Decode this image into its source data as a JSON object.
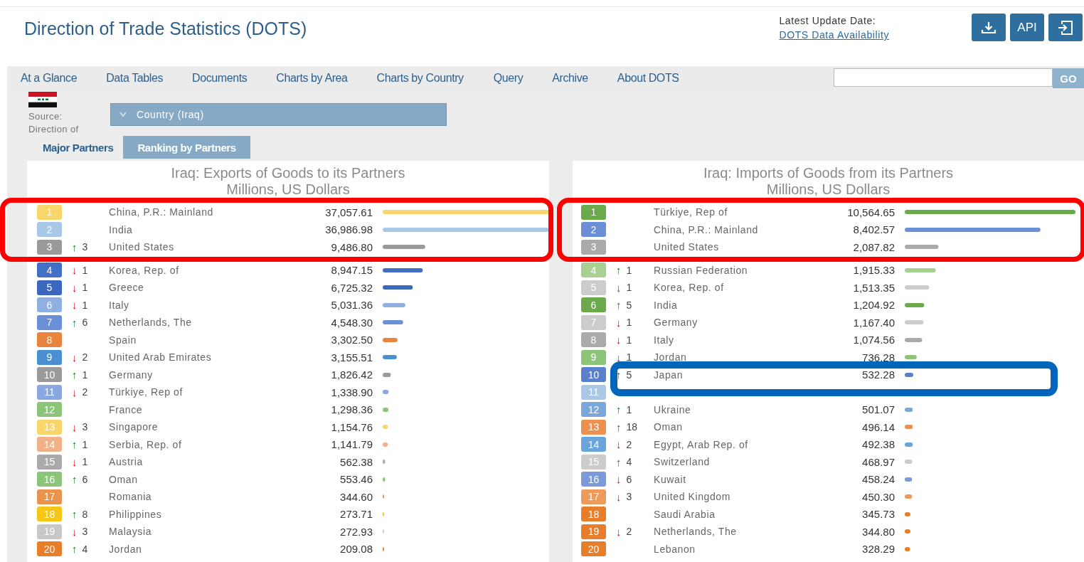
{
  "header": {
    "title": "Direction of Trade Statistics (DOTS)",
    "update_label": "Latest Update Date:",
    "availability_link": "DOTS Data Availability",
    "buttons": [
      {
        "kind": "download"
      },
      {
        "kind": "text",
        "label": "API"
      },
      {
        "kind": "export"
      }
    ]
  },
  "nav": {
    "items": [
      "At a Glance",
      "Data Tables",
      "Documents",
      "Charts by Area",
      "Charts by Country",
      "Query",
      "Archive",
      "About DOTS"
    ],
    "search_button": "GO"
  },
  "source": {
    "lines": [
      "Source:",
      "Direction of"
    ]
  },
  "country_dropdown": {
    "value": "Country (Iraq)"
  },
  "tabs": [
    {
      "label": "Major Partners",
      "selected": false
    },
    {
      "label": "Ranking by Partners",
      "selected": true
    }
  ],
  "panels": [
    {
      "title": "Iraq: Exports of Goods to its Partners",
      "subtitle": "Millions, US Dollars",
      "annotation": {
        "kind": "wide",
        "color": "#ff0000"
      },
      "rows": [
        {
          "rank": "1",
          "name": "China, P.R.: Mainland",
          "value": "37,057.61",
          "level": 1,
          "color": "#f8d66c",
          "boxed": true
        },
        {
          "rank": "2",
          "name": "India",
          "value": "36,986.98",
          "level": 0.998,
          "color": "#a9c8e8",
          "boxed": true
        },
        {
          "rank": "3",
          "change": {
            "arrow": "↑",
            "rising": true,
            "amount": "3"
          },
          "name": "United States",
          "value": "9,486.80",
          "level": 0.256,
          "color": "#9a9a9a",
          "boxed": true
        },
        {
          "rank": "4",
          "change": {
            "arrow": "↓",
            "rising": false,
            "amount": "1"
          },
          "name": "Korea, Rep. of",
          "value": "8,947.15",
          "level": 0.241,
          "color": "#4270c6",
          "boxed": false
        },
        {
          "rank": "5",
          "change": {
            "arrow": "↓",
            "rising": false,
            "amount": "1"
          },
          "name": "Greece",
          "value": "6,725.32",
          "level": 0.181,
          "color": "#3b67bf",
          "boxed": false
        },
        {
          "rank": "6",
          "change": {
            "arrow": "↓",
            "rising": false,
            "amount": "1"
          },
          "name": "Italy",
          "value": "5,031.36",
          "level": 0.136,
          "color": "#8fb0e0",
          "boxed": false
        },
        {
          "rank": "7",
          "change": {
            "arrow": "↑",
            "rising": true,
            "amount": "6"
          },
          "name": "Netherlands, The",
          "value": "4,548.30",
          "level": 0.123,
          "color": "#6a8fd6",
          "boxed": false
        },
        {
          "rank": "8",
          "name": "Spain",
          "value": "3,302.50",
          "level": 0.089,
          "color": "#e8843e",
          "boxed": false
        },
        {
          "rank": "9",
          "change": {
            "arrow": "↓",
            "rising": false,
            "amount": "2"
          },
          "name": "United Arab Emirates",
          "value": "3,155.51",
          "level": 0.085,
          "color": "#4a90d0",
          "boxed": false
        },
        {
          "rank": "10",
          "change": {
            "arrow": "↑",
            "rising": true,
            "amount": "1"
          },
          "name": "Germany",
          "value": "1,826.42",
          "level": 0.049,
          "color": "#9a9a9a",
          "boxed": false
        },
        {
          "rank": "11",
          "change": {
            "arrow": "↓",
            "rising": false,
            "amount": "2"
          },
          "name": "Türkiye, Rep of",
          "value": "1,338.90",
          "level": 0.036,
          "color": "#8aa8e0",
          "boxed": false
        },
        {
          "rank": "12",
          "name": "France",
          "value": "1,298.36",
          "level": 0.035,
          "color": "#8cc47a",
          "boxed": false
        },
        {
          "rank": "13",
          "change": {
            "arrow": "↓",
            "rising": false,
            "amount": "3"
          },
          "name": "Singapore",
          "value": "1,154.76",
          "level": 0.031,
          "color": "#f8d66c",
          "boxed": false
        },
        {
          "rank": "14",
          "change": {
            "arrow": "↑",
            "rising": true,
            "amount": "1"
          },
          "name": "Serbia, Rep. of",
          "value": "1,141.79",
          "level": 0.031,
          "color": "#f0b088",
          "boxed": false
        },
        {
          "rank": "15",
          "change": {
            "arrow": "↓",
            "rising": false,
            "amount": "1"
          },
          "name": "Austria",
          "value": "562.38",
          "level": 0.015,
          "color": "#aaaaaa",
          "boxed": false
        },
        {
          "rank": "16",
          "change": {
            "arrow": "↑",
            "rising": true,
            "amount": "6"
          },
          "name": "Oman",
          "value": "553.46",
          "level": 0.015,
          "color": "#8cc47a",
          "boxed": false
        },
        {
          "rank": "17",
          "name": "Romania",
          "value": "344.60",
          "level": 0.009,
          "color": "#e8944e",
          "boxed": false
        },
        {
          "rank": "18",
          "change": {
            "arrow": "↑",
            "rising": true,
            "amount": "8"
          },
          "name": "Philippines",
          "value": "273.71",
          "level": 0.007,
          "color": "#f5c518",
          "boxed": false
        },
        {
          "rank": "19",
          "change": {
            "arrow": "↓",
            "rising": false,
            "amount": "3"
          },
          "name": "Malaysia",
          "value": "272.93",
          "level": 0.007,
          "color": "#c8c8c8",
          "boxed": false
        },
        {
          "rank": "20",
          "change": {
            "arrow": "↑",
            "rising": true,
            "amount": "4"
          },
          "name": "Jordan",
          "value": "209.08",
          "level": 0.006,
          "color": "#e87d2a",
          "boxed": false
        }
      ]
    },
    {
      "title": "Iraq: Imports of Goods from its Partners",
      "subtitle": "Millions, US Dollars",
      "annotation": {
        "kind": "wide",
        "color": "#ff0000"
      },
      "second_annotation": {
        "kind": "inset",
        "color": "#0066bb"
      },
      "rows": [
        {
          "rank": "1",
          "name": "Türkiye, Rep of",
          "value": "10,564.65",
          "level": 1,
          "color": "#6aaa4a",
          "boxed": true,
          "boxed_second": false
        },
        {
          "rank": "2",
          "name": "China, P.R.: Mainland",
          "value": "8,402.57",
          "level": 0.795,
          "color": "#6a8fd6",
          "boxed": true,
          "boxed_second": false
        },
        {
          "rank": "3",
          "name": "United States",
          "value": "2,087.82",
          "level": 0.198,
          "color": "#aaaaaa",
          "boxed": true,
          "boxed_second": false
        },
        {
          "rank": "4",
          "change": {
            "arrow": "↑",
            "rising": true,
            "amount": "1"
          },
          "name": "Russian Federation",
          "value": "1,915.33",
          "level": 0.181,
          "color": "#a8d090",
          "boxed": false,
          "boxed_second": false
        },
        {
          "rank": "5",
          "change": {
            "arrow": "↓",
            "rising": false,
            "amount": "1"
          },
          "name": "Korea, Rep. of",
          "value": "1,513.35",
          "level": 0.143,
          "color": "#cccccc",
          "boxed": false,
          "boxed_second": false
        },
        {
          "rank": "6",
          "change": {
            "arrow": "↑",
            "rising": true,
            "amount": "5"
          },
          "name": "India",
          "value": "1,204.92",
          "level": 0.114,
          "color": "#6aaa4a",
          "boxed": false,
          "boxed_second": false
        },
        {
          "rank": "7",
          "change": {
            "arrow": "↓",
            "rising": false,
            "amount": "1"
          },
          "name": "Germany",
          "value": "1,167.40",
          "level": 0.11,
          "color": "#cccccc",
          "boxed": false,
          "boxed_second": false
        },
        {
          "rank": "8",
          "change": {
            "arrow": "↓",
            "rising": false,
            "amount": "1"
          },
          "name": "Italy",
          "value": "1,074.56",
          "level": 0.102,
          "color": "#aaaaaa",
          "boxed": false,
          "boxed_second": false
        },
        {
          "rank": "9",
          "change": {
            "arrow": "↓",
            "rising": false,
            "amount": "1"
          },
          "name": "Jordan",
          "value": "736.28",
          "level": 0.07,
          "color": "#8cc47a",
          "boxed": false,
          "boxed_second": false
        },
        {
          "rank": "10",
          "change": {
            "arrow": "↑",
            "rising": true,
            "amount": "5"
          },
          "name": "Japan",
          "value": "532.28",
          "level": 0.05,
          "color": "#5a80cc",
          "boxed": false,
          "boxed_second": true
        },
        {
          "rank": "11",
          "color": "#a9c8e8",
          "boxed": false,
          "boxed_second": true
        },
        {
          "rank": "12",
          "change": {
            "arrow": "↑",
            "rising": true,
            "amount": "1"
          },
          "name": "Ukraine",
          "value": "501.07",
          "level": 0.047,
          "color": "#7aa8dc",
          "boxed": false,
          "boxed_second": false
        },
        {
          "rank": "13",
          "change": {
            "arrow": "↑",
            "rising": true,
            "amount": "18"
          },
          "name": "Oman",
          "value": "496.14",
          "level": 0.047,
          "color": "#ee9050",
          "boxed": false,
          "boxed_second": false
        },
        {
          "rank": "14",
          "change": {
            "arrow": "↓",
            "rising": false,
            "amount": "2"
          },
          "name": "Egypt, Arab Rep. of",
          "value": "492.38",
          "level": 0.047,
          "color": "#6aa4dc",
          "boxed": false,
          "boxed_second": false
        },
        {
          "rank": "15",
          "change": {
            "arrow": "↑",
            "rising": true,
            "amount": "4"
          },
          "name": "Switzerland",
          "value": "468.97",
          "level": 0.044,
          "color": "#cccccc",
          "boxed": false,
          "boxed_second": false
        },
        {
          "rank": "16",
          "change": {
            "arrow": "↓",
            "rising": false,
            "amount": "6"
          },
          "name": "Kuwait",
          "value": "458.24",
          "level": 0.043,
          "color": "#7a9ada",
          "boxed": false,
          "boxed_second": false
        },
        {
          "rank": "17",
          "change": {
            "arrow": "↓",
            "rising": false,
            "amount": "3"
          },
          "name": "United Kingdom",
          "value": "450.30",
          "level": 0.043,
          "color": "#f09a5a",
          "boxed": false,
          "boxed_second": false
        },
        {
          "rank": "18",
          "name": "Saudi Arabia",
          "value": "345.73",
          "level": 0.033,
          "color": "#e87d2a",
          "boxed": false,
          "boxed_second": false
        },
        {
          "rank": "19",
          "change": {
            "arrow": "↓",
            "rising": false,
            "amount": "2"
          },
          "name": "Netherlands, The",
          "value": "344.80",
          "level": 0.033,
          "color": "#e87d2a",
          "boxed": false,
          "boxed_second": false
        },
        {
          "rank": "20",
          "name": "Lebanon",
          "value": "328.29",
          "level": 0.031,
          "color": "#e87d2a",
          "boxed": false,
          "boxed_second": false
        }
      ]
    }
  ]
}
